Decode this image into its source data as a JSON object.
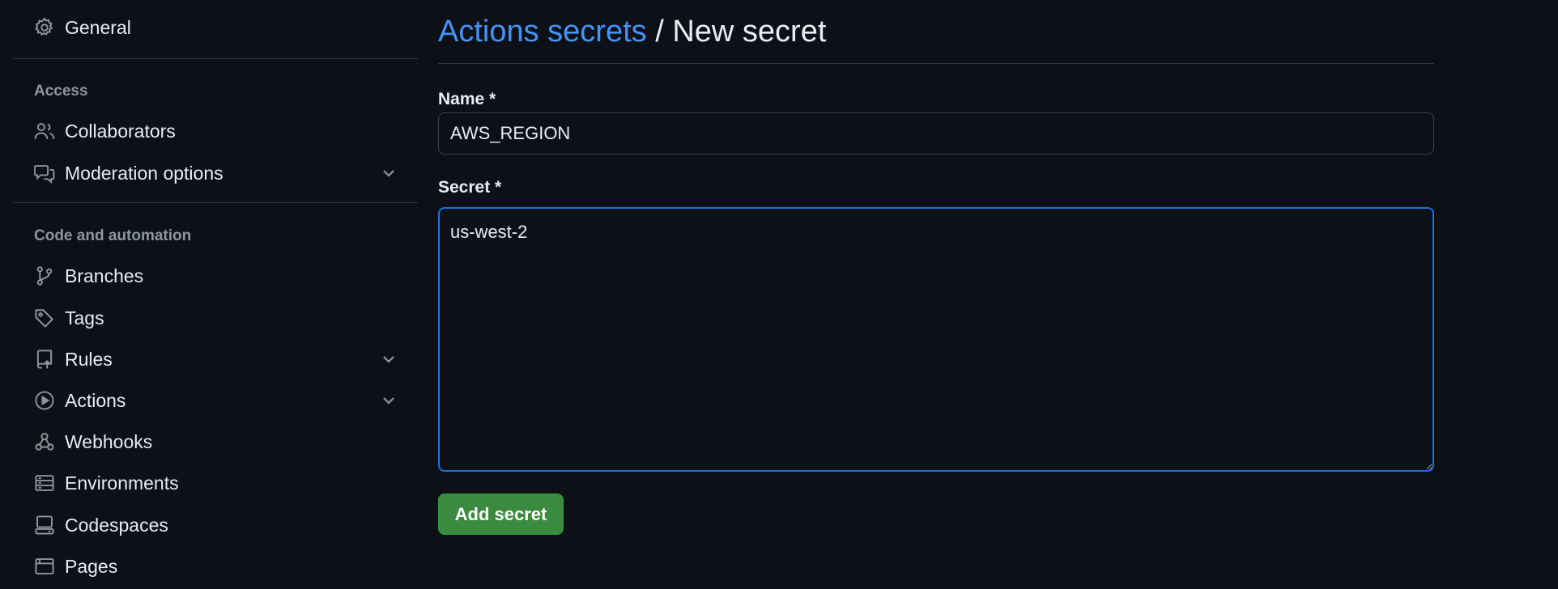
{
  "sidebar": {
    "general": {
      "label": "General",
      "icon": "gear-icon"
    },
    "sections": {
      "access": "Access",
      "code_and_automation": "Code and automation"
    },
    "access_items": [
      {
        "label": "Collaborators",
        "icon": "people-icon",
        "expandable": false
      },
      {
        "label": "Moderation options",
        "icon": "comment-discussion-icon",
        "expandable": true
      }
    ],
    "code_items": [
      {
        "label": "Branches",
        "icon": "git-branch-icon",
        "expandable": false
      },
      {
        "label": "Tags",
        "icon": "tag-icon",
        "expandable": false
      },
      {
        "label": "Rules",
        "icon": "repo-push-icon",
        "expandable": true
      },
      {
        "label": "Actions",
        "icon": "play-icon",
        "expandable": true
      },
      {
        "label": "Webhooks",
        "icon": "webhook-icon",
        "expandable": false
      },
      {
        "label": "Environments",
        "icon": "server-icon",
        "expandable": false
      },
      {
        "label": "Codespaces",
        "icon": "codespaces-icon",
        "expandable": false
      },
      {
        "label": "Pages",
        "icon": "browser-icon",
        "expandable": false
      }
    ]
  },
  "header": {
    "breadcrumb": "Actions secrets",
    "separator": "/",
    "current": "New secret"
  },
  "form": {
    "name_label": "Name *",
    "name_value": "AWS_REGION",
    "secret_label": "Secret *",
    "secret_value": "us-west-2",
    "submit_label": "Add secret"
  },
  "colors": {
    "background": "#0d1117",
    "link": "#4493f8",
    "focus_border": "#1f6feb",
    "button": "#238636",
    "muted": "#8d96a0",
    "border": "#30363d"
  }
}
